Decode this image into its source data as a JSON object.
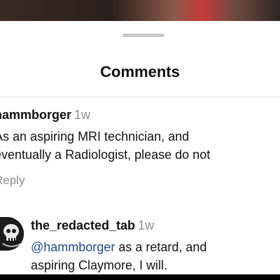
{
  "sheet": {
    "title": "Comments"
  },
  "comments": [
    {
      "username": "hammborger",
      "time": "1w",
      "lines": [
        "As an aspiring MRI technician, and",
        "eventually a Radiologist, please do not"
      ],
      "reply_label": "Reply"
    },
    {
      "username": "the_redacted_tab",
      "time": "1w",
      "mention": "@hammborger",
      "line1_rest": " as a retard, and",
      "line2": "aspiring Claymore, I will.",
      "avatar_icon": "skull-avatar-icon"
    }
  ],
  "colors": {
    "mention": "#1e4c8f",
    "muted": "#8e8e8e"
  }
}
